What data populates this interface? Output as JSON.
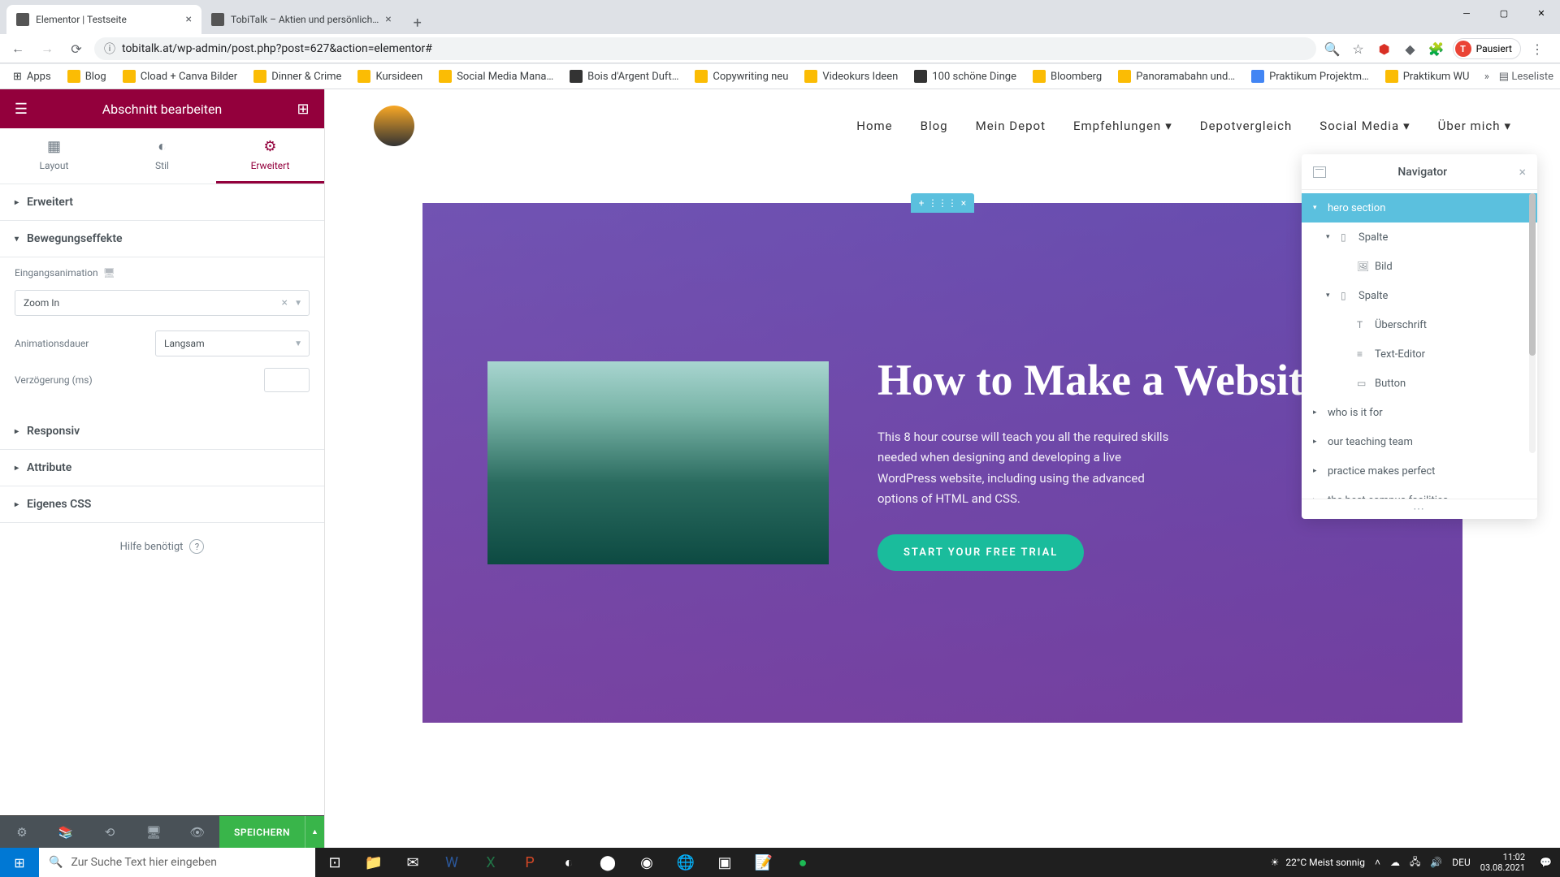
{
  "browser": {
    "tabs": [
      {
        "title": "Elementor | Testseite",
        "active": true
      },
      {
        "title": "TobiTalk – Aktien und persönlich…",
        "active": false
      }
    ],
    "url": "tobitalk.at/wp-admin/post.php?post=627&action=elementor#",
    "profile_status": "Pausiert",
    "bookmarks": [
      "Apps",
      "Blog",
      "Cload + Canva Bilder",
      "Dinner & Crime",
      "Kursideen",
      "Social Media Mana…",
      "Bois d'Argent Duft…",
      "Copywriting neu",
      "Videokurs Ideen",
      "100 schöne Dinge",
      "Bloomberg",
      "Panoramabahn und…",
      "Praktikum Projektm…",
      "Praktikum WU"
    ],
    "reading_list": "Leseliste"
  },
  "sidebar": {
    "title": "Abschnitt bearbeiten",
    "tabs": {
      "layout": "Layout",
      "style": "Stil",
      "advanced": "Erweitert"
    },
    "sections": {
      "advanced": "Erweitert",
      "motion": "Bewegungseffekte",
      "responsive": "Responsiv",
      "attributes": "Attribute",
      "custom_css": "Eigenes CSS"
    },
    "fields": {
      "entrance_label": "Eingangsanimation",
      "entrance_value": "Zoom In",
      "duration_label": "Animationsdauer",
      "duration_value": "Langsam",
      "delay_label": "Verzögerung (ms)",
      "delay_value": ""
    },
    "help": "Hilfe benötigt",
    "save": "SPEICHERN"
  },
  "preview": {
    "nav": [
      "Home",
      "Blog",
      "Mein Depot",
      "Empfehlungen",
      "Depotvergleich",
      "Social Media",
      "Über mich"
    ],
    "hero": {
      "title": "How to Make a Website",
      "body": "This 8 hour course will teach you all the required skills needed when designing and developing a live WordPress website, including using the advanced options of HTML and CSS.",
      "cta": "START YOUR FREE TRIAL"
    }
  },
  "navigator": {
    "title": "Navigator",
    "items": [
      {
        "label": "hero section",
        "depth": 0,
        "selected": true,
        "icon": "▾"
      },
      {
        "label": "Spalte",
        "depth": 1,
        "icon": "▾"
      },
      {
        "label": "Bild",
        "depth": 2,
        "icon": ""
      },
      {
        "label": "Spalte",
        "depth": 1,
        "icon": "▾"
      },
      {
        "label": "Überschrift",
        "depth": 2,
        "icon": ""
      },
      {
        "label": "Text-Editor",
        "depth": 2,
        "icon": ""
      },
      {
        "label": "Button",
        "depth": 2,
        "icon": ""
      },
      {
        "label": "who is it for",
        "depth": 0,
        "icon": "▸"
      },
      {
        "label": "our teaching team",
        "depth": 0,
        "icon": "▸"
      },
      {
        "label": "practice makes perfect",
        "depth": 0,
        "icon": "▸"
      },
      {
        "label": "the best campus facilities",
        "depth": 0,
        "icon": "▸"
      }
    ]
  },
  "taskbar": {
    "search_placeholder": "Zur Suche Text hier eingeben",
    "weather": "22°C  Meist sonnig",
    "lang": "DEU",
    "time": "11:02",
    "date": "03.08.2021"
  }
}
